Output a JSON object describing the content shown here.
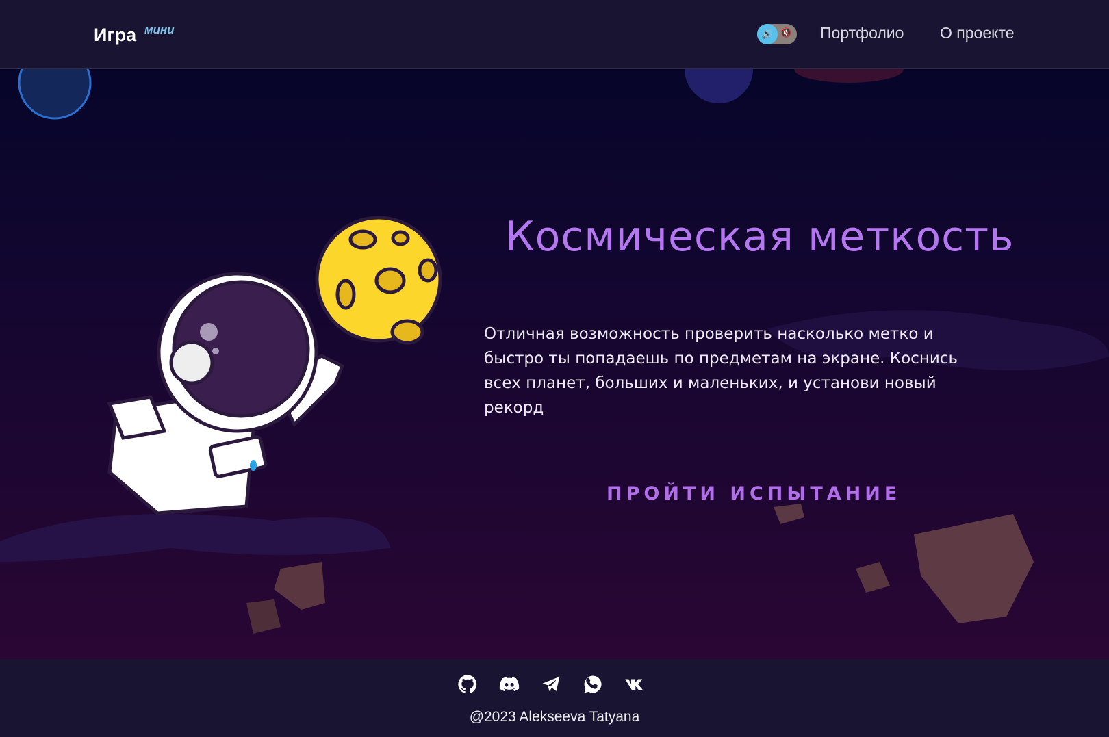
{
  "header": {
    "logo": "Игра",
    "logo_sup": "мини",
    "sound_toggle": {
      "state": "on",
      "on_icon": "speaker-icon",
      "off_icon": "speaker-mute-icon"
    },
    "nav": [
      "Портфолио",
      "О проекте"
    ]
  },
  "hero": {
    "title": "Космическая меткость",
    "description": "Отличная возможность проверить насколько метко и быстро ты попадаешь по предметам на экране. Коснись всех планет, больших и маленьких, и установи новый рекорд",
    "cta": "ПРОЙТИ ИСПЫТАНИЕ"
  },
  "footer": {
    "social_icons": [
      "github-icon",
      "discord-icon",
      "telegram-icon",
      "whatsapp-icon",
      "vk-icon"
    ],
    "copyright": "@2023 Alekseeva Tatyana"
  },
  "colors": {
    "accent": "#b577f0",
    "header_bg": "#1a1433",
    "toggle": "#58c0ea"
  }
}
